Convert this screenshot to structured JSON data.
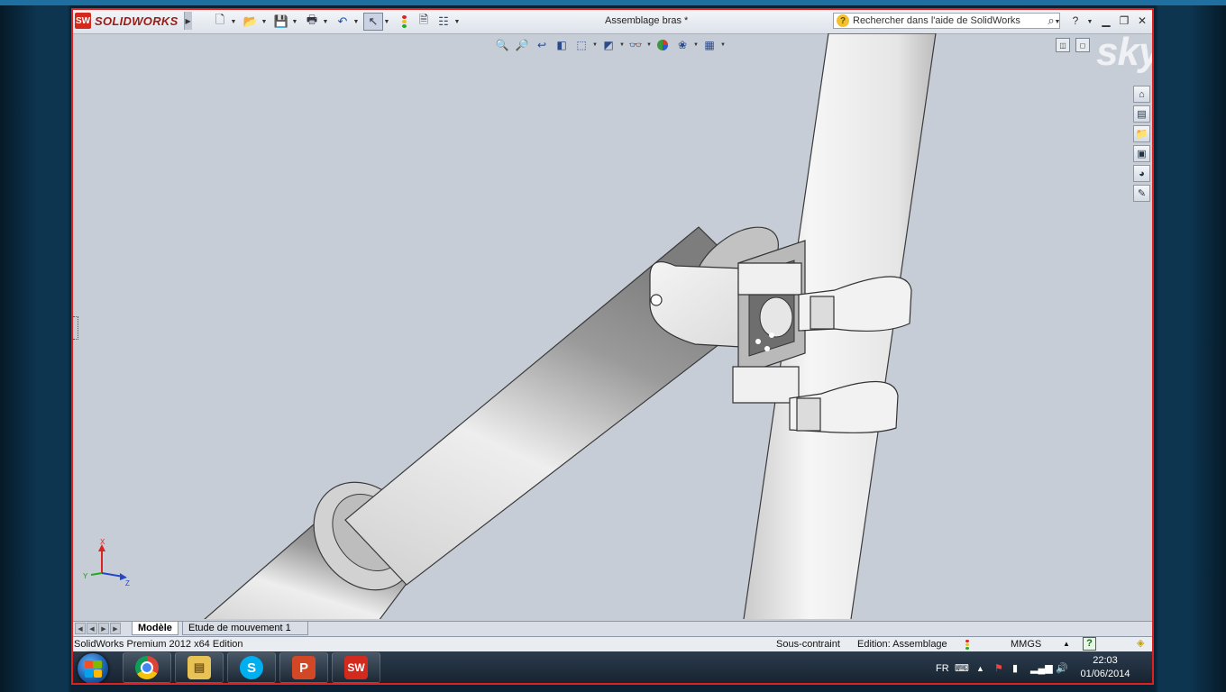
{
  "window": {
    "app_logo": "SOLIDWORKS",
    "title": "Assemblage bras *",
    "search_placeholder": "Rechercher dans l'aide de SolidWorks"
  },
  "watermark": "skype",
  "triad": {
    "x": "X",
    "y": "Y",
    "z": "Z"
  },
  "tabs": [
    {
      "label": "Modèle",
      "active": true
    },
    {
      "label": "Etude de mouvement 1",
      "active": false
    }
  ],
  "status": {
    "product": "SolidWorks Premium 2012 x64 Edition",
    "constraint": "Sous-contraint",
    "edition": "Edition: Assemblage",
    "units": "MMGS"
  },
  "taskbar": {
    "apps": [
      "windows-start",
      "chrome",
      "file-explorer",
      "skype",
      "powerpoint",
      "solidworks"
    ],
    "language": "FR",
    "time": "22:03",
    "date": "01/06/2014"
  },
  "colors": {
    "border": "#e02020",
    "viewport_bg": "#c7cdd6",
    "part_light": "#f0f0f0",
    "part_dark": "#8e8e8e"
  }
}
